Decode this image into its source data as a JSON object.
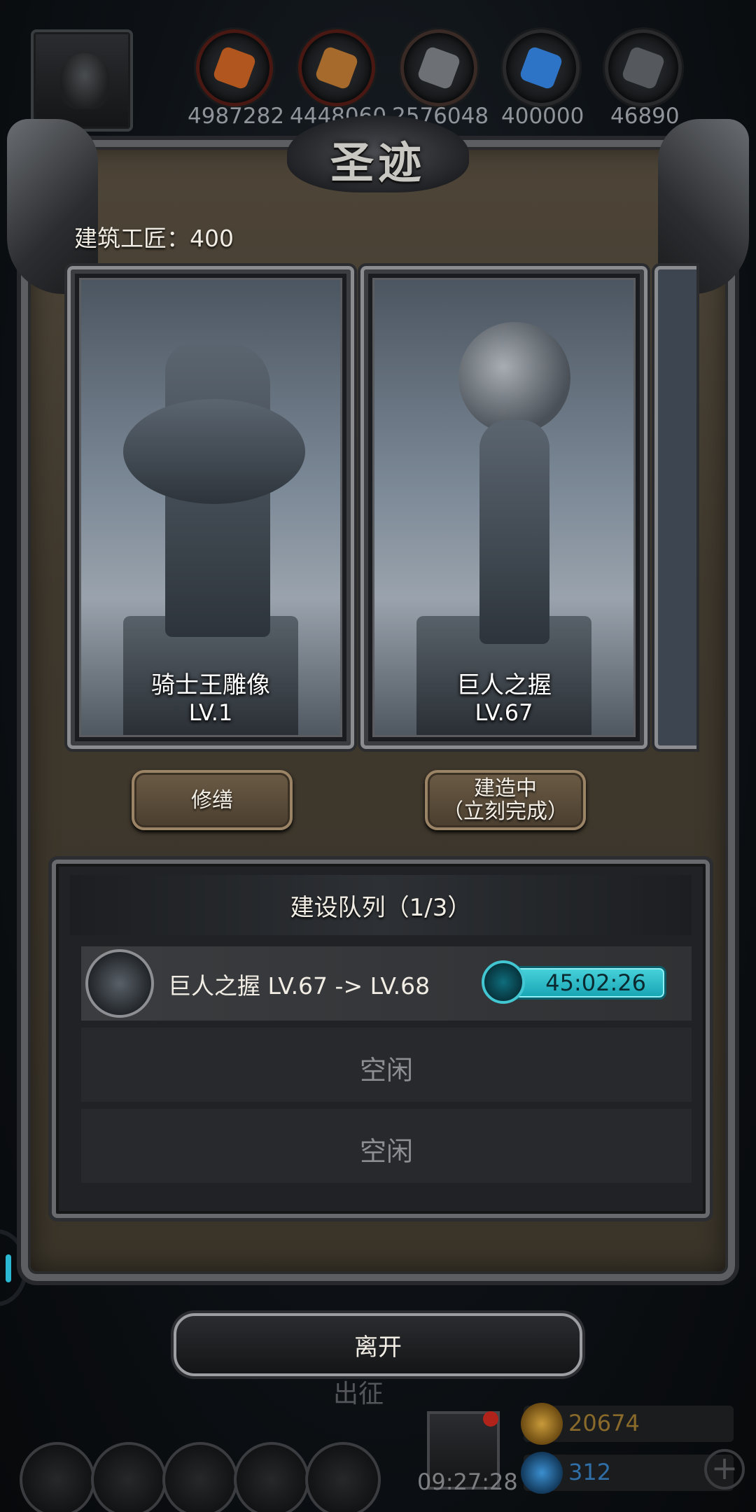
{
  "resources": [
    {
      "icon": "food-icon",
      "value": "4987282",
      "color": "#b0561e"
    },
    {
      "icon": "wood-icon",
      "value": "4448060",
      "color": "#a66a2c"
    },
    {
      "icon": "stone-icon",
      "value": "2576048",
      "color": "#6d7074"
    },
    {
      "icon": "crystal-icon",
      "value": "400000",
      "color": "#2e74c6"
    },
    {
      "icon": "iron-icon",
      "value": "46890",
      "color": "#55585c"
    }
  ],
  "panel": {
    "title": "圣迹",
    "builders_label": "建筑工匠：400"
  },
  "monuments": [
    {
      "name": "骑士王雕像",
      "level": "LV.1",
      "button": "修缮",
      "button_sub": ""
    },
    {
      "name": "巨人之握",
      "level": "LV.67",
      "button": "建造中",
      "button_sub": "（立刻完成）"
    }
  ],
  "queue": {
    "title": "建设队列（1/3）",
    "active": {
      "label": "巨人之握 LV.67 -> LV.68",
      "timer": "45:02:26"
    },
    "idle_label": "空闲"
  },
  "leave_label": "离开",
  "hud": {
    "expedition": "出征",
    "clock": "09:27:28",
    "gold": "20674",
    "gems": "312",
    "plus": "+"
  },
  "colors": {
    "accent_timer": "#2fc0cc",
    "panel_bg": "#3f382d",
    "frame": "#8a8c90"
  }
}
